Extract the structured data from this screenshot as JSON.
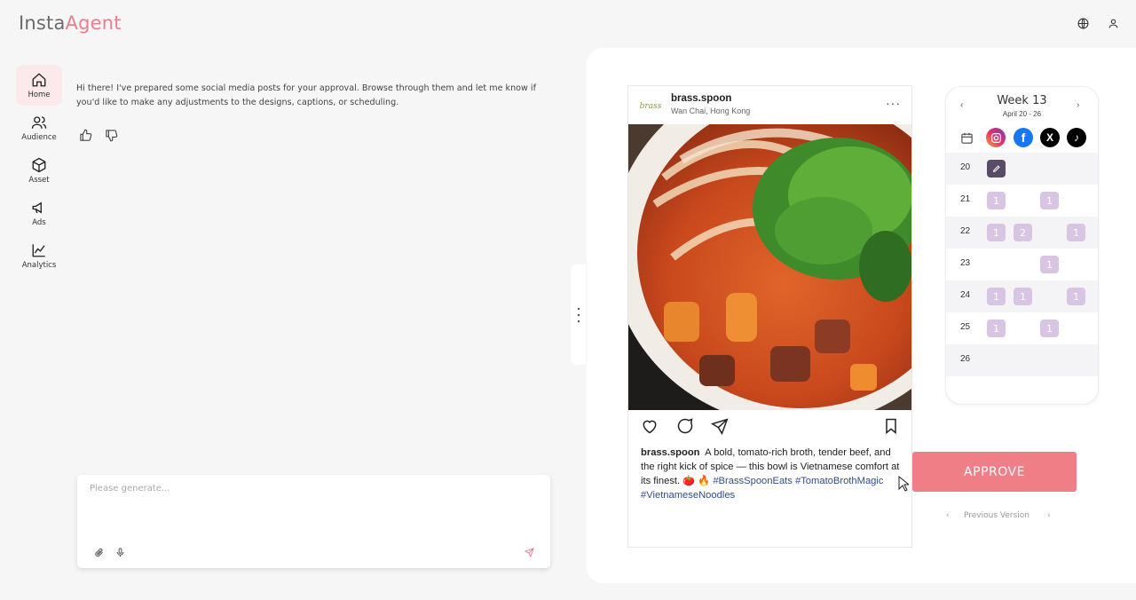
{
  "app": {
    "logo_part1": "Insta",
    "logo_part2": "Agent"
  },
  "header": {
    "icons": [
      "globe-icon",
      "user-icon"
    ]
  },
  "sidebar": {
    "items": [
      {
        "label": "Home",
        "icon": "home-icon",
        "active": true
      },
      {
        "label": "Audience",
        "icon": "users-icon"
      },
      {
        "label": "Asset",
        "icon": "box-icon"
      },
      {
        "label": "Ads",
        "icon": "megaphone-icon"
      },
      {
        "label": "Analytics",
        "icon": "chart-line-icon"
      }
    ]
  },
  "chat": {
    "message": "Hi there! I've prepared some social media posts for your approval. Browse through them and let me know if you'd like to make any adjustments to the designs, captions, or scheduling.",
    "feedback_icons": [
      "thumbs-up-icon",
      "thumbs-down-icon"
    ]
  },
  "composer": {
    "placeholder": "Please generate...",
    "tools": [
      "paperclip-icon",
      "microphone-icon",
      "send-icon"
    ]
  },
  "post": {
    "username": "brass.spoon",
    "location": "Wan Chai, Hong Kong",
    "avatar_text": "brass",
    "more": "···",
    "caption_user": "brass.spoon",
    "caption_text": "A bold, tomato-rich broth, tender beef, and the right kick of spice — this bowl is Vietnamese comfort at its finest. 🍅 🔥 ",
    "hashtags": "#BrassSpoonEats #TomatoBrothMagic #VietnameseNoodles"
  },
  "calendar": {
    "title": "Week 13",
    "range": "April 20 - 26",
    "prev": "‹",
    "next": "›",
    "networks": [
      "instagram",
      "facebook",
      "x",
      "tiktok"
    ],
    "days": [
      {
        "day": "20",
        "cells": [
          "edit",
          "",
          "",
          ""
        ]
      },
      {
        "day": "21",
        "cells": [
          "1",
          "",
          "1",
          ""
        ]
      },
      {
        "day": "22",
        "cells": [
          "1",
          "2",
          "",
          "1"
        ]
      },
      {
        "day": "23",
        "cells": [
          "",
          "",
          "1",
          ""
        ]
      },
      {
        "day": "24",
        "cells": [
          "1",
          "1",
          "",
          "1"
        ]
      },
      {
        "day": "25",
        "cells": [
          "1",
          "",
          "1",
          ""
        ]
      },
      {
        "day": "26",
        "cells": [
          "",
          "",
          "",
          ""
        ]
      }
    ]
  },
  "approve_label": "APPROVE",
  "previous_version_label": "Previous Version",
  "colors": {
    "accent": "#f07e86",
    "brand_pink": "#ec7d8a",
    "chip": "#d8c4e3",
    "chip_edit": "#5a4c66"
  }
}
